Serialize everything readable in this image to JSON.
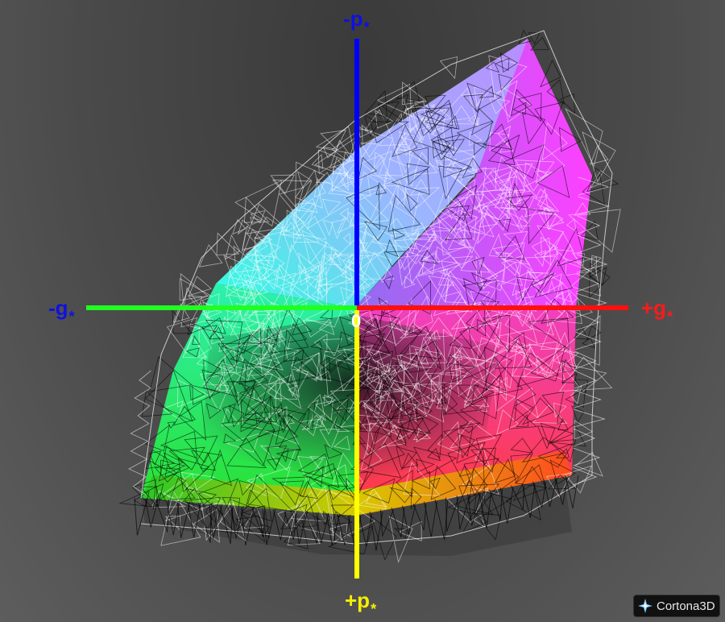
{
  "axes": {
    "neg_p": {
      "main": "-p",
      "sub": "*",
      "color": "#1010e0"
    },
    "pos_p": {
      "main": "+p",
      "sub": "*",
      "color": "#f5f000"
    },
    "neg_g": {
      "main": "-g",
      "sub": "*",
      "color": "#1010e0"
    },
    "pos_g": {
      "main": "+g",
      "sub": "*",
      "color": "#ff1a1a"
    }
  },
  "origin": "0",
  "axis_colors": {
    "blue": "#0000ff",
    "yellow": "#ffff00",
    "green": "#20ff20",
    "red": "#ff1010"
  },
  "brand": {
    "name": "Cortona3D",
    "icon": "cortona-logo-icon"
  }
}
